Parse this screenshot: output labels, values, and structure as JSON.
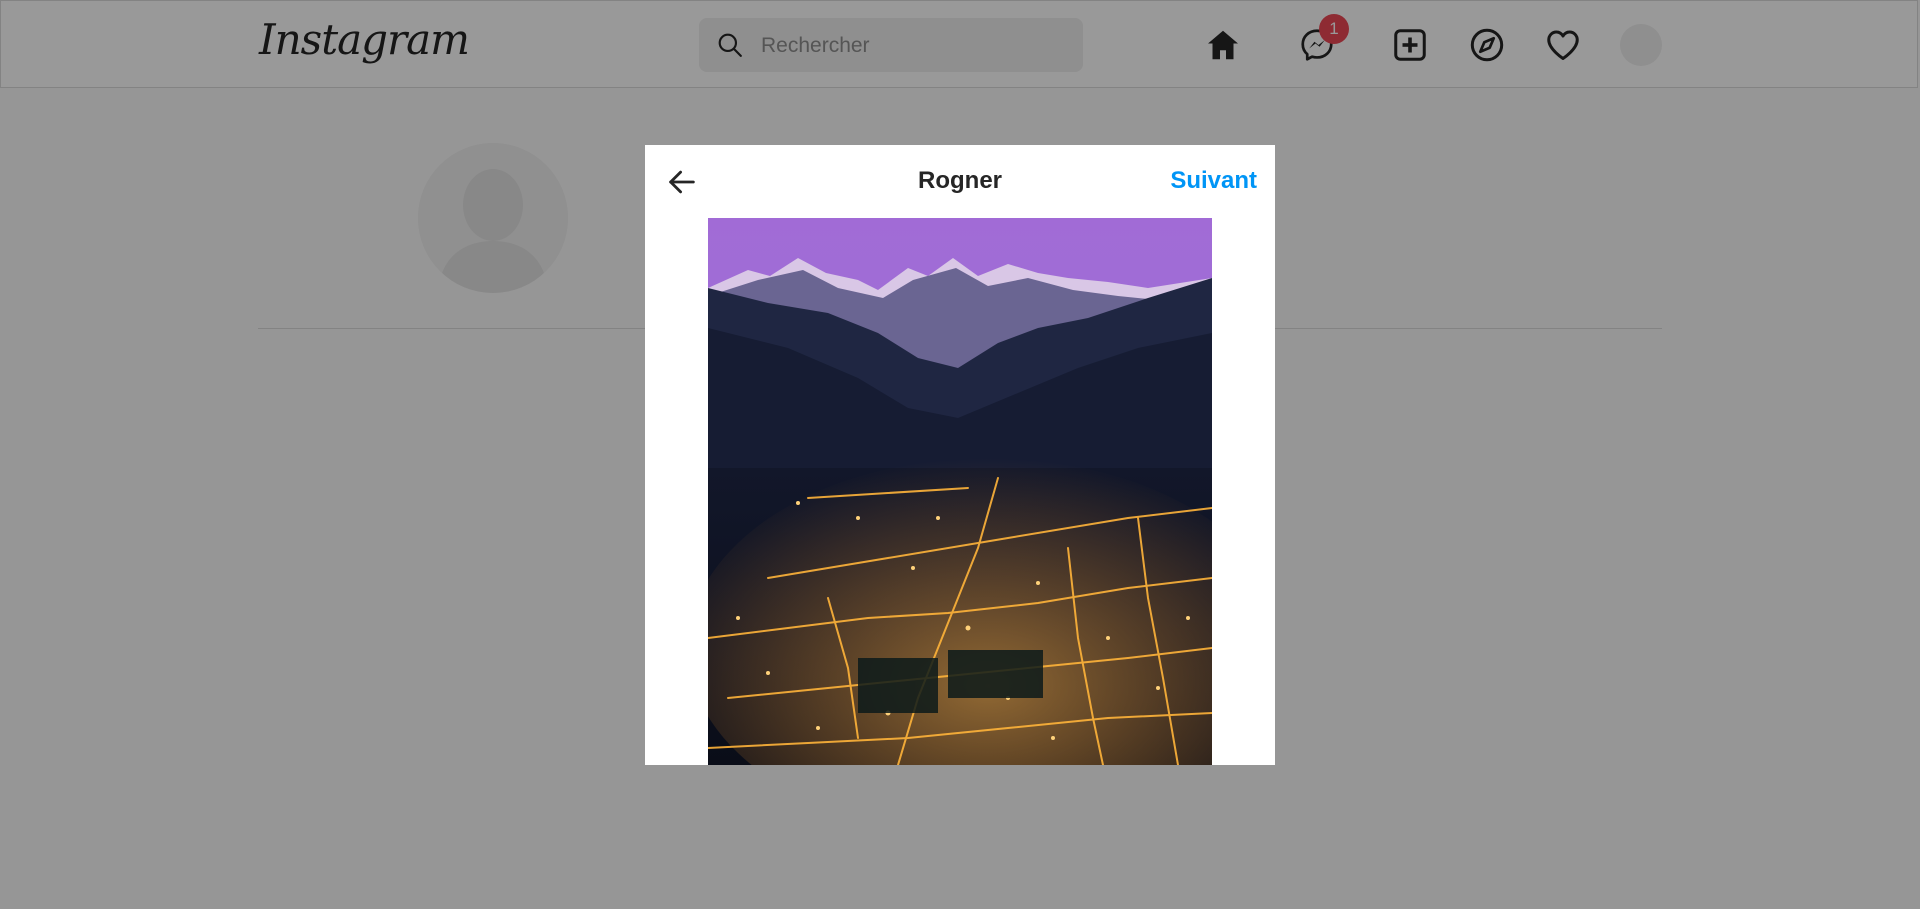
{
  "brand": {
    "name": "Instagram"
  },
  "search": {
    "placeholder": "Rechercher"
  },
  "nav": {
    "icons": [
      "home-icon",
      "messenger-icon",
      "new-post-icon",
      "explore-icon",
      "activity-heart-icon"
    ],
    "messages_badge": "1"
  },
  "colors": {
    "accent": "#0095f6",
    "badge": "#ed4956",
    "overlay": "rgba(0,0,0,0.4)"
  },
  "modal": {
    "title": "Rogner",
    "next_label": "Suivant",
    "back_icon": "arrow-left-icon"
  }
}
